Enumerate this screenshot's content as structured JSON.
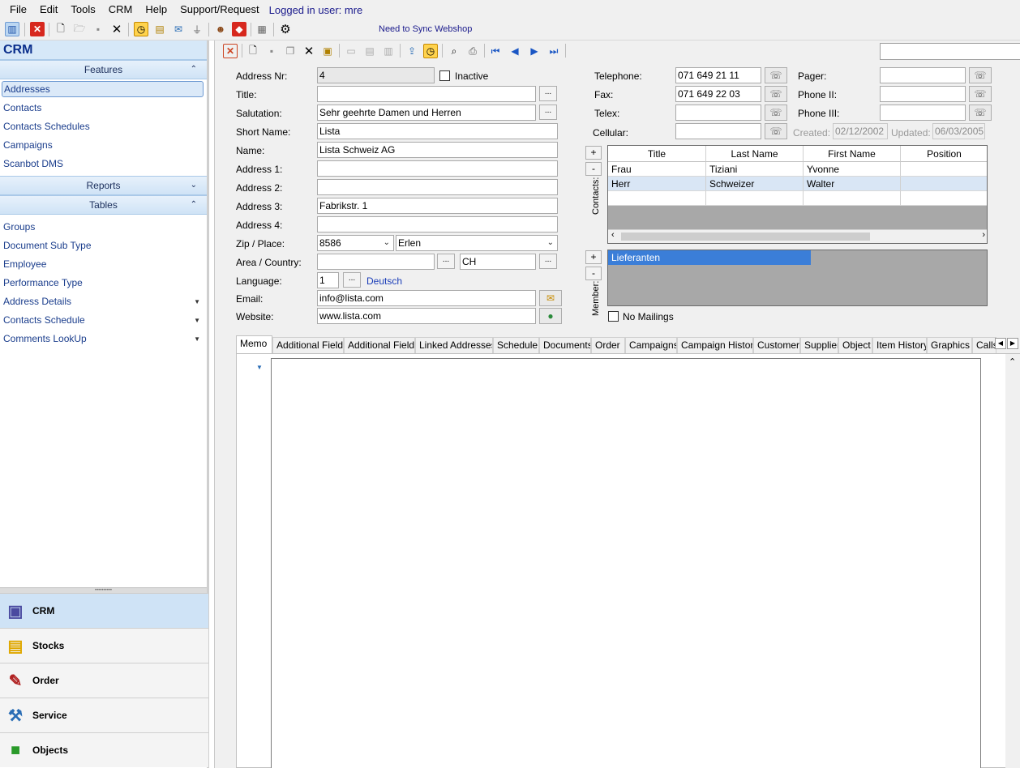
{
  "menu": {
    "items": [
      "File",
      "Edit",
      "Tools",
      "CRM",
      "Help",
      "Support/Request"
    ],
    "logged_in": "Logged in user: mre"
  },
  "toolbar": {
    "sync_label": "Need to Sync Webshop",
    "icons": [
      "layout-icon",
      "close-red-icon",
      "new-document-icon",
      "open-folder-icon",
      "save-icon",
      "delete-icon",
      "clock-icon",
      "stack-icon",
      "mail-icon",
      "filter-icon",
      "person-icon",
      "red-diamond-icon",
      "grid-icon",
      "gear-icon"
    ]
  },
  "sidebar": {
    "title": "CRM",
    "features": {
      "label": "Features",
      "items": [
        "Addresses",
        "Contacts",
        "Contacts  Schedules",
        "Campaigns",
        "Scanbot DMS"
      ]
    },
    "reports": {
      "label": "Reports"
    },
    "tables": {
      "label": "Tables",
      "items": [
        "Groups",
        "Document Sub Type",
        "Employee",
        "Performance Type",
        "Address Details",
        "Contacts  Schedule",
        "Comments LookUp"
      ]
    },
    "modules": [
      "CRM",
      "Stocks",
      "Order",
      "Service",
      "Objects"
    ]
  },
  "form": {
    "labels": {
      "address_nr": "Address Nr:",
      "title": "Title:",
      "salutation": "Salutation:",
      "short_name": "Short Name:",
      "name": "Name:",
      "address1": "Address 1:",
      "address2": "Address 2:",
      "address3": "Address 3:",
      "address4": "Address 4:",
      "zip_place": "Zip / Place:",
      "area_country": "Area / Country:",
      "language": "Language:",
      "email": "Email:",
      "website": "Website:",
      "inactive": "Inactive",
      "telephone": "Telephone:",
      "fax": "Fax:",
      "telex": "Telex:",
      "cellular": "Cellular:",
      "pager": "Pager:",
      "phone2": "Phone II:",
      "phone3": "Phone III:",
      "created": "Created:",
      "updated": "Updated:",
      "contacts": "Contacts:",
      "member": "Member:",
      "no_mailings": "No Mailings"
    },
    "values": {
      "address_nr": "4",
      "title": "",
      "salutation": "Sehr geehrte Damen und Herren",
      "short_name": "Lista",
      "name": "Lista Schweiz AG",
      "address1": "",
      "address2": "",
      "address3": "Fabrikstr. 1",
      "address4": "",
      "zip": "8586",
      "place": "Erlen",
      "area": "",
      "country": "CH",
      "language_code": "1",
      "language_name": "Deutsch",
      "email": "info@lista.com",
      "website": "www.lista.com",
      "telephone": "071 649 21 11",
      "fax": "071 649 22 03",
      "telex": "",
      "cellular": "",
      "pager": "",
      "phone2": "",
      "phone3": "",
      "created": "02/12/2002",
      "updated": "06/03/2005"
    },
    "ellipsis": "...",
    "plus": "+",
    "minus": "-"
  },
  "contacts_grid": {
    "columns": [
      "Title",
      "Last Name",
      "First Name",
      "Position"
    ],
    "rows": [
      [
        "Frau",
        "Tiziani",
        "Yvonne",
        ""
      ],
      [
        "Herr",
        "Schweizer",
        "Walter",
        ""
      ]
    ]
  },
  "member": {
    "items": [
      "Lieferanten"
    ]
  },
  "tabs": [
    "Memo",
    "Additional Fields",
    "Additional Fields",
    "Linked Addresses",
    "Schedule",
    "Documents",
    "Order",
    "Campaigns",
    "Campaign History",
    "Customer",
    "Supplier",
    "Object",
    "Item History",
    "Graphics",
    "Calls"
  ]
}
